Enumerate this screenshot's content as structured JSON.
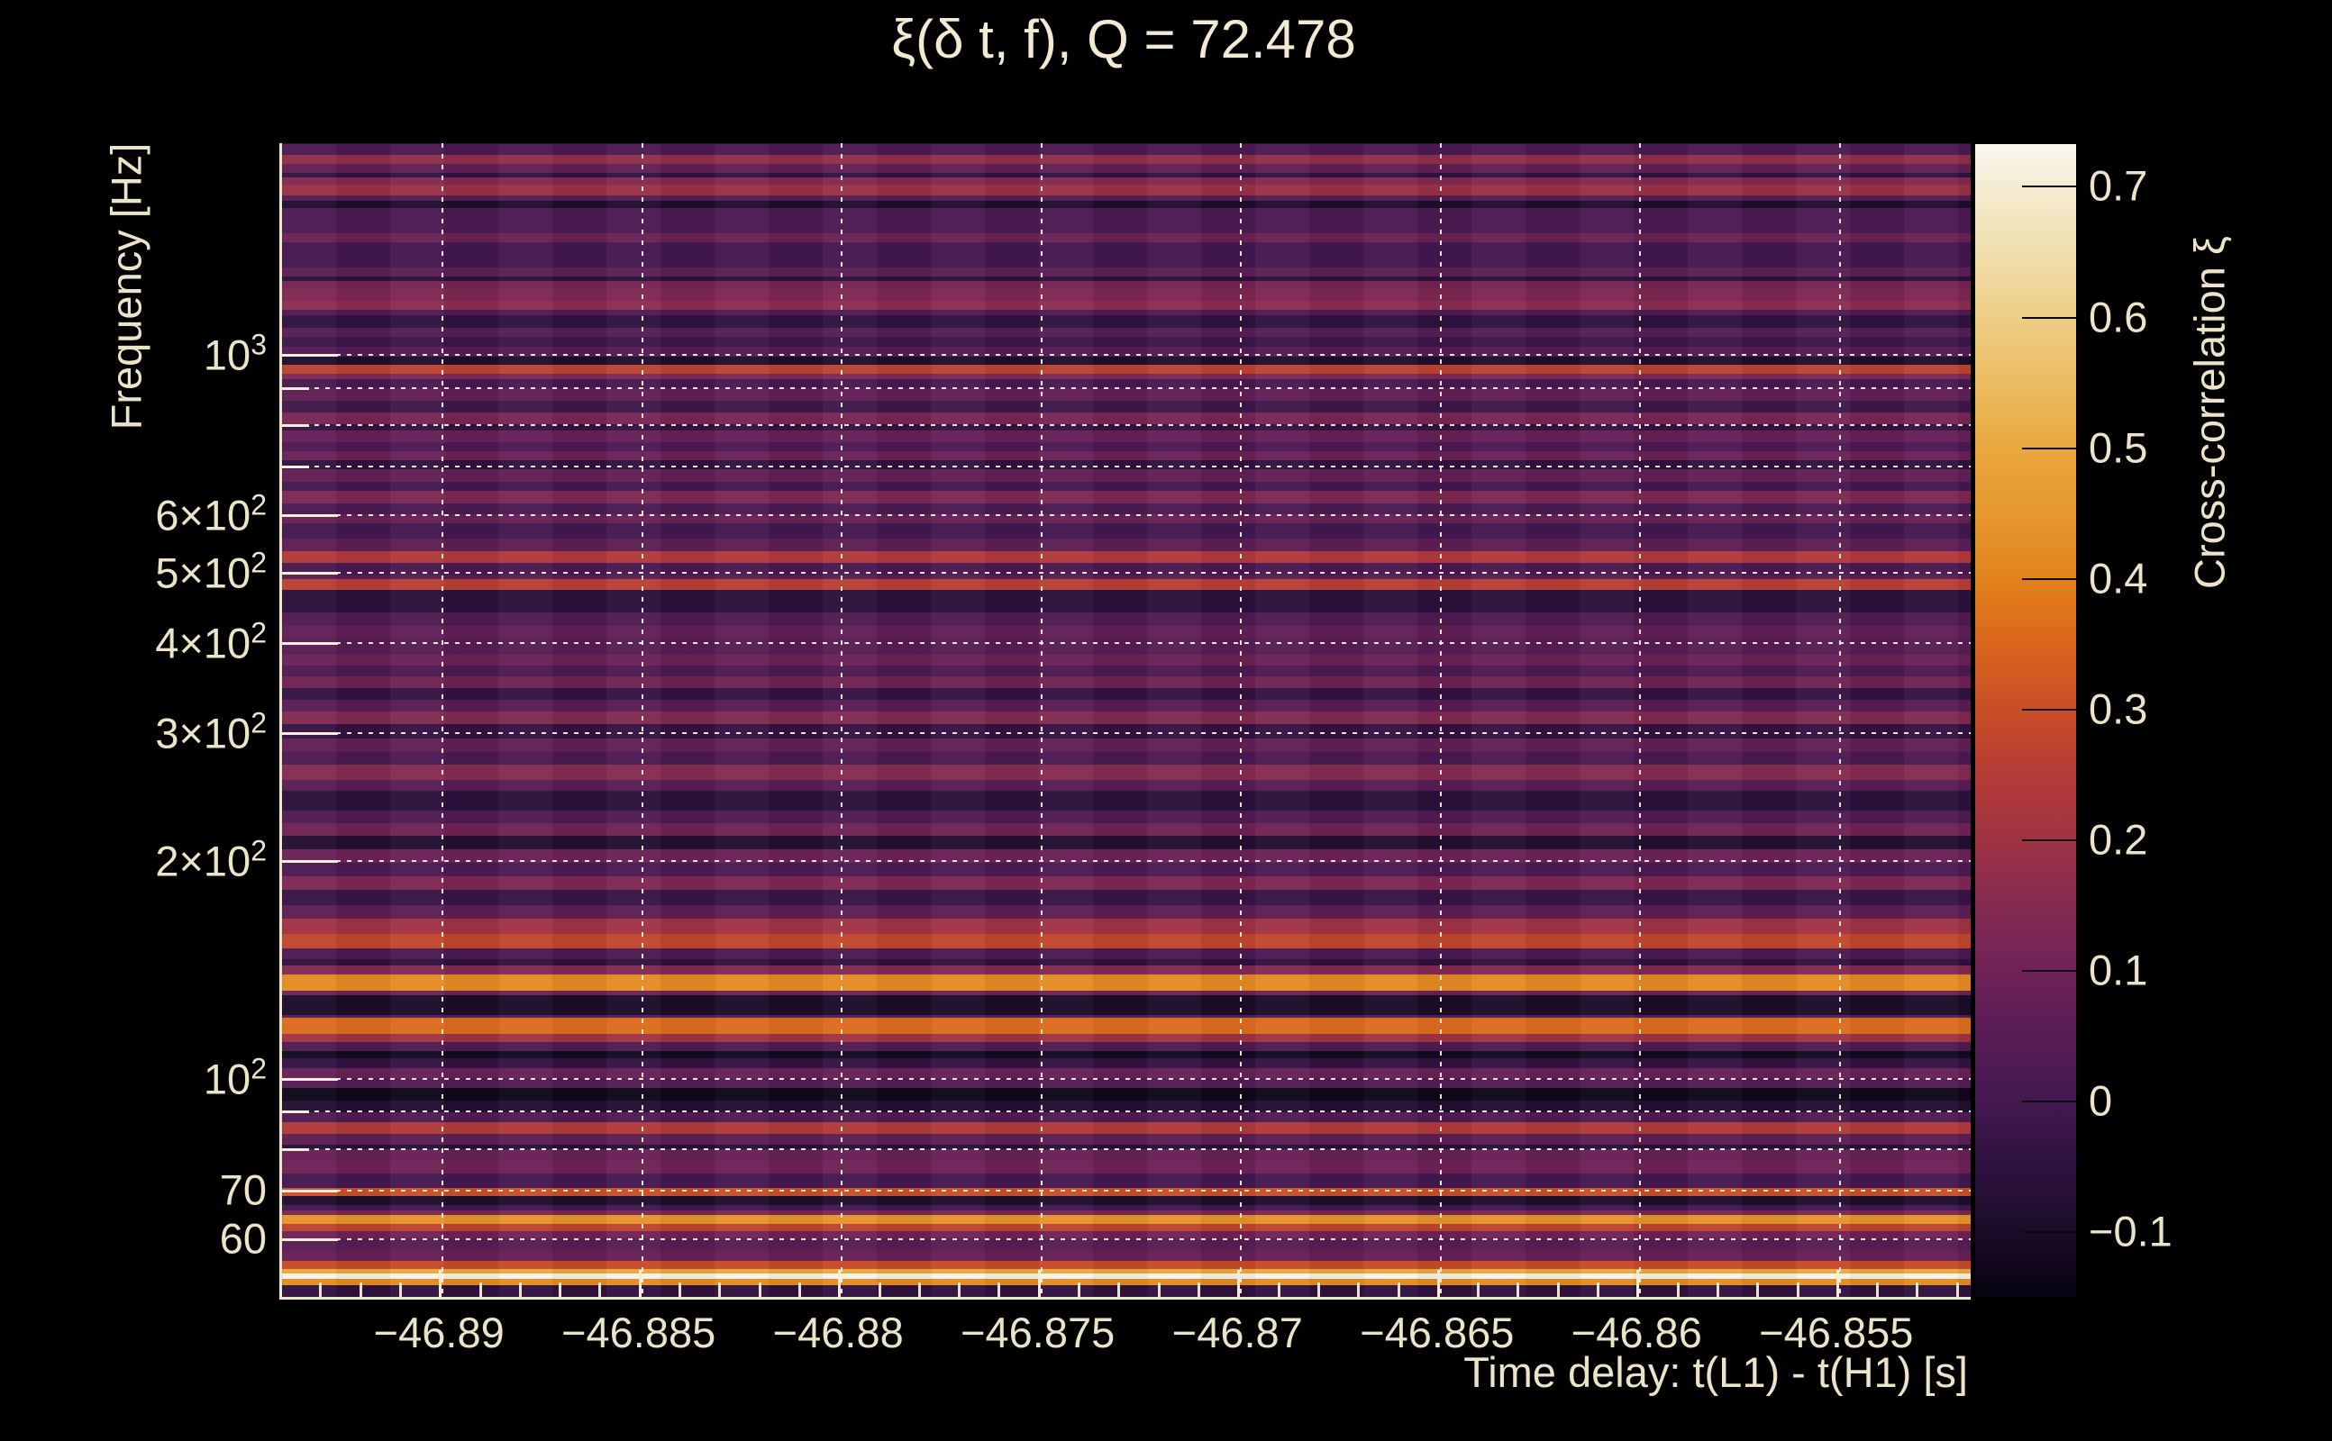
{
  "title": "ξ(δ t, f), Q = 72.478",
  "axes": {
    "xlabel": "Time delay: t(L1) - t(H1) [s]",
    "ylabel": "Frequency [Hz]",
    "x_ticks": [
      {
        "value": -46.89,
        "label": "−46.89"
      },
      {
        "value": -46.885,
        "label": "−46.885"
      },
      {
        "value": -46.88,
        "label": "−46.88"
      },
      {
        "value": -46.875,
        "label": "−46.875"
      },
      {
        "value": -46.87,
        "label": "−46.87"
      },
      {
        "value": -46.865,
        "label": "−46.865"
      },
      {
        "value": -46.86,
        "label": "−46.86"
      },
      {
        "value": -46.855,
        "label": "−46.855"
      }
    ],
    "y_ticks": [
      {
        "f": 1000,
        "base": "10",
        "exp": "3"
      },
      {
        "f": 600,
        "base": "6×10",
        "exp": "2"
      },
      {
        "f": 500,
        "base": "5×10",
        "exp": "2"
      },
      {
        "f": 400,
        "base": "4×10",
        "exp": "2"
      },
      {
        "f": 300,
        "base": "3×10",
        "exp": "2"
      },
      {
        "f": 200,
        "base": "2×10",
        "exp": "2"
      },
      {
        "f": 100,
        "base": "10",
        "exp": "2"
      },
      {
        "f": 70,
        "base": "70",
        "exp": ""
      },
      {
        "f": 60,
        "base": "60",
        "exp": ""
      }
    ]
  },
  "colorbar": {
    "label": "Cross-correlation ξ",
    "min": -0.15,
    "max": 0.732,
    "ticks": [
      {
        "value": 0.7,
        "label": "0.7"
      },
      {
        "value": 0.6,
        "label": "0.6"
      },
      {
        "value": 0.5,
        "label": "0.5"
      },
      {
        "value": 0.4,
        "label": "0.4"
      },
      {
        "value": 0.3,
        "label": "0.3"
      },
      {
        "value": 0.2,
        "label": "0.2"
      },
      {
        "value": 0.1,
        "label": "0.1"
      },
      {
        "value": 0.0,
        "label": "0"
      },
      {
        "value": -0.1,
        "label": "−0.1"
      }
    ]
  },
  "colors": {
    "background": "#000000",
    "text": "#ece4c8",
    "spine": "#efe7cd",
    "grid": "#f6f0dc"
  },
  "chart_data": {
    "type": "heatmap",
    "title": "ξ(δ t, f), Q = 72.478",
    "xlabel": "Time delay: t(L1) - t(H1) [s]",
    "ylabel": "Frequency [Hz]",
    "colorbar_label": "Cross-correlation ξ",
    "x_range": [
      -46.894,
      -46.8517
    ],
    "x_major_ticks": [
      -46.89,
      -46.885,
      -46.88,
      -46.875,
      -46.87,
      -46.865,
      -46.86,
      -46.855
    ],
    "x_minor_step": 0.001,
    "y_scale": "log",
    "y_range_hz": [
      49.8,
      1954
    ],
    "gridlines_hz": [
      1000,
      900,
      800,
      700,
      600,
      500,
      400,
      300,
      200,
      100,
      90,
      80,
      70,
      60
    ],
    "labeled_hz": [
      1000,
      600,
      500,
      400,
      300,
      200,
      100,
      70,
      60
    ],
    "legend_position": "right-colorbar",
    "grid": true,
    "colormap_stops": [
      [
        -0.152,
        "#06030f"
      ],
      [
        -0.1,
        "#1b0c29"
      ],
      [
        -0.05,
        "#2f123e"
      ],
      [
        0.0,
        "#431850"
      ],
      [
        0.05,
        "#581d55"
      ],
      [
        0.1,
        "#6f2256"
      ],
      [
        0.15,
        "#862b51"
      ],
      [
        0.2,
        "#a03343"
      ],
      [
        0.25,
        "#b53b36"
      ],
      [
        0.3,
        "#c94e26"
      ],
      [
        0.35,
        "#da661c"
      ],
      [
        0.4,
        "#e2831c"
      ],
      [
        0.45,
        "#e6982e"
      ],
      [
        0.5,
        "#e9a83e"
      ],
      [
        0.55,
        "#ebbc63"
      ],
      [
        0.6,
        "#edce87"
      ],
      [
        0.65,
        "#f1dfae"
      ],
      [
        0.7,
        "#f4ecd3"
      ],
      [
        0.732,
        "#f9f7f2"
      ]
    ],
    "bands_format": [
      "freq_hi_hz",
      "freq_lo_hz",
      "xi"
    ],
    "bands": [
      [
        1980,
        1950,
        -0.08
      ],
      [
        1950,
        1883,
        0.02
      ],
      [
        1883,
        1830,
        0.17
      ],
      [
        1830,
        1778,
        0.07
      ],
      [
        1778,
        1752,
        -0.05
      ],
      [
        1752,
        1712,
        0.14
      ],
      [
        1712,
        1653,
        0.19
      ],
      [
        1653,
        1629,
        0.04
      ],
      [
        1629,
        1592,
        -0.09
      ],
      [
        1592,
        1468,
        0.02
      ],
      [
        1468,
        1426,
        0.09
      ],
      [
        1426,
        1318,
        0.0
      ],
      [
        1318,
        1280,
        0.06
      ],
      [
        1280,
        1262,
        -0.06
      ],
      [
        1262,
        1233,
        0.11
      ],
      [
        1233,
        1184,
        0.13
      ],
      [
        1184,
        1151,
        0.16
      ],
      [
        1151,
        1131,
        0.03
      ],
      [
        1131,
        1086,
        -0.05
      ],
      [
        1086,
        1055,
        0.05
      ],
      [
        1055,
        1024,
        -0.02
      ],
      [
        1024,
        991,
        0.04
      ],
      [
        991,
        966,
        -0.09
      ],
      [
        966,
        938,
        0.27
      ],
      [
        938,
        922,
        0.13
      ],
      [
        922,
        896,
        0.01
      ],
      [
        896,
        886,
        0.06
      ],
      [
        886,
        861,
        0.07
      ],
      [
        861,
        829,
        -0.01
      ],
      [
        829,
        799,
        0.12
      ],
      [
        799,
        783,
        -0.04
      ],
      [
        783,
        755,
        0.08
      ],
      [
        755,
        734,
        0.02
      ],
      [
        734,
        713,
        0.09
      ],
      [
        713,
        693,
        -0.05
      ],
      [
        693,
        665,
        0.07
      ],
      [
        665,
        647,
        0.0
      ],
      [
        647,
        621,
        0.13
      ],
      [
        621,
        600,
        0.02
      ],
      [
        600,
        583,
        0.08
      ],
      [
        583,
        555,
        0.0
      ],
      [
        555,
        534,
        0.06
      ],
      [
        534,
        515,
        0.24
      ],
      [
        515,
        496,
        0.01
      ],
      [
        496,
        489,
        0.05
      ],
      [
        489,
        472,
        0.26
      ],
      [
        472,
        439,
        -0.06
      ],
      [
        439,
        421,
        0.03
      ],
      [
        421,
        405,
        0.07
      ],
      [
        405,
        384,
        0.05
      ],
      [
        384,
        371,
        0.09
      ],
      [
        371,
        359,
        0.02
      ],
      [
        359,
        345,
        0.1
      ],
      [
        345,
        333,
        -0.04
      ],
      [
        333,
        321,
        0.05
      ],
      [
        321,
        308,
        0.14
      ],
      [
        308,
        294,
        -0.04
      ],
      [
        294,
        282,
        0.07
      ],
      [
        282,
        271,
        0.02
      ],
      [
        271,
        258,
        0.15
      ],
      [
        258,
        249,
        0.05
      ],
      [
        249,
        234,
        -0.06
      ],
      [
        234,
        225,
        0.03
      ],
      [
        225,
        216,
        0.1
      ],
      [
        216,
        207,
        -0.08
      ],
      [
        207,
        198,
        0.09
      ],
      [
        198,
        190,
        0.02
      ],
      [
        190,
        182,
        0.13
      ],
      [
        182,
        173,
        -0.03
      ],
      [
        173,
        166,
        0.06
      ],
      [
        166,
        158,
        0.2
      ],
      [
        158,
        151,
        0.28
      ],
      [
        151,
        146,
        0.02
      ],
      [
        146,
        143,
        -0.05
      ],
      [
        143,
        139,
        0.14
      ],
      [
        139,
        132,
        0.42
      ],
      [
        132,
        130,
        0.1
      ],
      [
        130,
        122,
        -0.1
      ],
      [
        122,
        121,
        0.04
      ],
      [
        121,
        115,
        0.36
      ],
      [
        115,
        112,
        0.2
      ],
      [
        112,
        109,
        0.03
      ],
      [
        109,
        106.5,
        -0.12
      ],
      [
        106.5,
        103,
        -0.04
      ],
      [
        103,
        100,
        0.08
      ],
      [
        100,
        96.9,
        0.04
      ],
      [
        96.9,
        93,
        -0.13
      ],
      [
        93,
        89.6,
        -0.08
      ],
      [
        89.6,
        86.9,
        0.03
      ],
      [
        86.9,
        83.7,
        0.24
      ],
      [
        83.7,
        80.9,
        0.06
      ],
      [
        80.9,
        79.7,
        -0.07
      ],
      [
        79.7,
        76.8,
        0.08
      ],
      [
        76.8,
        73.8,
        0.1
      ],
      [
        73.8,
        70.5,
        0.0
      ],
      [
        70.5,
        68.7,
        0.3
      ],
      [
        68.7,
        66.8,
        -0.09
      ],
      [
        66.8,
        65.5,
        0.0
      ],
      [
        65.5,
        64.6,
        0.12
      ],
      [
        64.6,
        62.8,
        0.44
      ],
      [
        62.8,
        61.4,
        0.27
      ],
      [
        61.4,
        60.0,
        0.1
      ],
      [
        60.0,
        57.6,
        0.05
      ],
      [
        57.6,
        55.8,
        0.08
      ],
      [
        55.8,
        54.5,
        0.29
      ],
      [
        54.5,
        53.7,
        0.5
      ],
      [
        53.7,
        52.8,
        0.72
      ],
      [
        52.8,
        51.7,
        0.42
      ],
      [
        51.7,
        49.8,
        -0.05
      ]
    ]
  }
}
